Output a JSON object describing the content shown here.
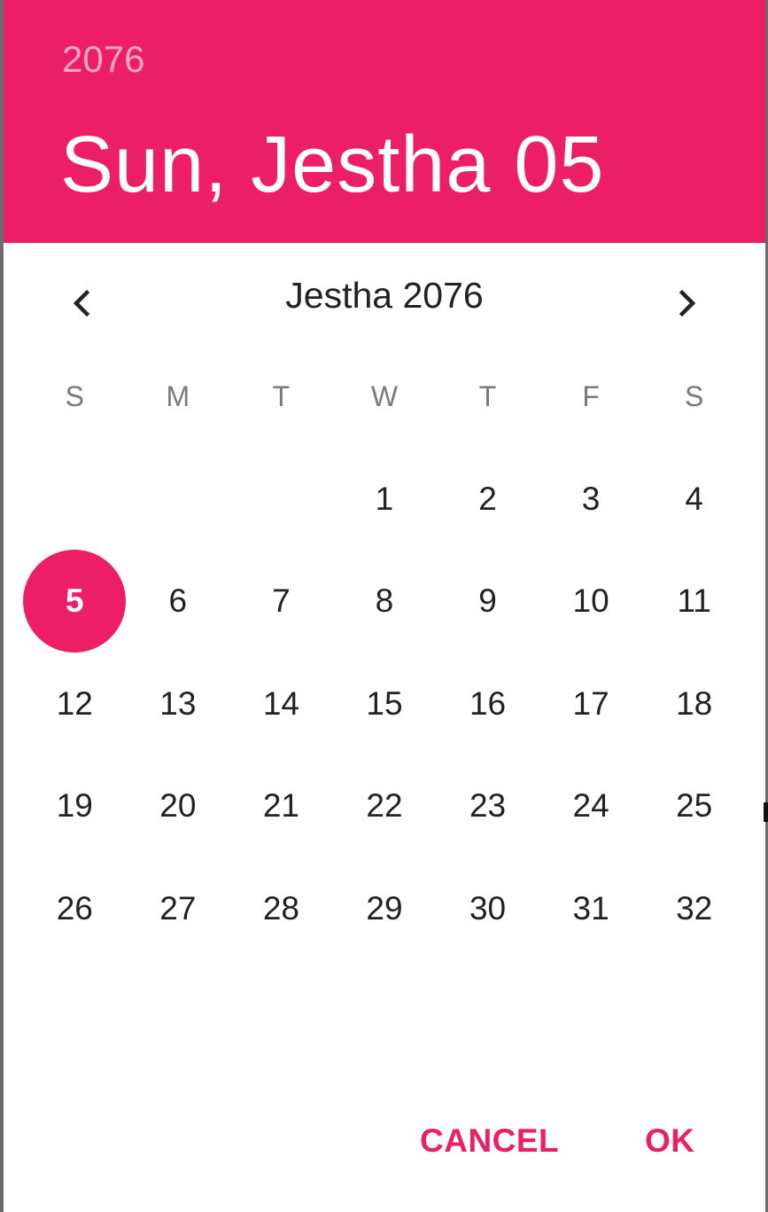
{
  "colors": {
    "accent": "#ec1f66",
    "header_year_text": "#f7a8c4",
    "weekday_text": "#7a7a7a",
    "day_text": "#222222"
  },
  "header": {
    "year": "2076",
    "selected_date": "Sun, Jestha 05"
  },
  "calendar": {
    "month_title": "Jestha 2076",
    "prev_icon": "chevron-left-icon",
    "next_icon": "chevron-right-icon",
    "weekdays": [
      "S",
      "M",
      "T",
      "W",
      "T",
      "F",
      "S"
    ],
    "weeks": [
      [
        "",
        "",
        "",
        "1",
        "2",
        "3",
        "4"
      ],
      [
        "5",
        "6",
        "7",
        "8",
        "9",
        "10",
        "11"
      ],
      [
        "12",
        "13",
        "14",
        "15",
        "16",
        "17",
        "18"
      ],
      [
        "19",
        "20",
        "21",
        "22",
        "23",
        "24",
        "25"
      ],
      [
        "26",
        "27",
        "28",
        "29",
        "30",
        "31",
        "32"
      ]
    ],
    "selected_day": "5"
  },
  "actions": {
    "cancel_label": "CANCEL",
    "ok_label": "OK"
  }
}
